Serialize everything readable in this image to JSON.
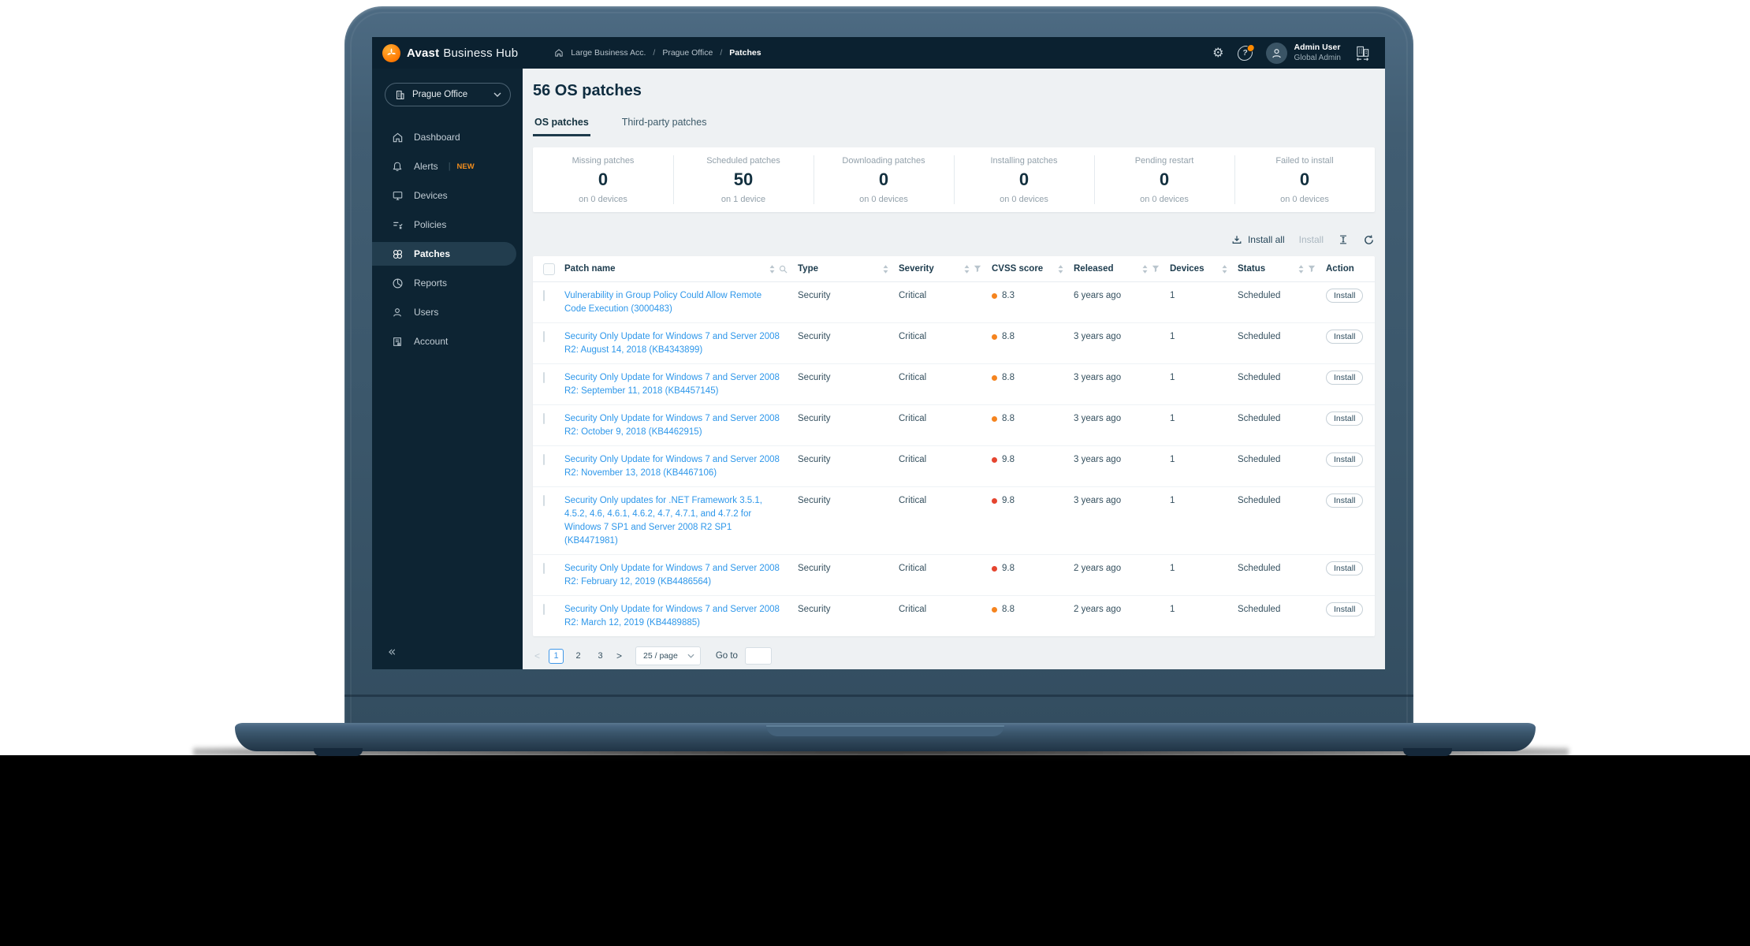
{
  "topbar": {
    "brand_bold": "Avast",
    "brand_rest": "Business Hub",
    "breadcrumbs": [
      "Large Business Acc.",
      "Prague Office",
      "Patches"
    ],
    "user": {
      "name": "Admin User",
      "role": "Global Admin"
    }
  },
  "sidebar": {
    "selector": "Prague Office",
    "collapse_glyph": "«",
    "items": [
      {
        "id": "dashboard",
        "label": "Dashboard",
        "active": false
      },
      {
        "id": "alerts",
        "label": "Alerts",
        "badge": "NEW",
        "active": false
      },
      {
        "id": "devices",
        "label": "Devices",
        "active": false
      },
      {
        "id": "policies",
        "label": "Policies",
        "active": false
      },
      {
        "id": "patches",
        "label": "Patches",
        "active": true
      },
      {
        "id": "reports",
        "label": "Reports",
        "active": false
      },
      {
        "id": "users",
        "label": "Users",
        "active": false
      },
      {
        "id": "account",
        "label": "Account",
        "active": false
      }
    ]
  },
  "main": {
    "title": "56 OS patches",
    "tabs": [
      {
        "label": "OS patches",
        "active": true
      },
      {
        "label": "Third-party patches",
        "active": false
      }
    ],
    "stats": [
      {
        "label": "Missing patches",
        "value": "0",
        "sub": "on 0 devices"
      },
      {
        "label": "Scheduled patches",
        "value": "50",
        "sub": "on 1 device"
      },
      {
        "label": "Downloading patches",
        "value": "0",
        "sub": "on 0 devices"
      },
      {
        "label": "Installing patches",
        "value": "0",
        "sub": "on 0 devices"
      },
      {
        "label": "Pending restart",
        "value": "0",
        "sub": "on 0 devices"
      },
      {
        "label": "Failed to install",
        "value": "0",
        "sub": "on 0 devices"
      }
    ],
    "toolbar": {
      "install_all": "Install all",
      "install": "Install"
    },
    "table": {
      "headers": [
        {
          "label": "",
          "checkbox": true
        },
        {
          "label": "Patch name",
          "sort": true,
          "search": true
        },
        {
          "label": "Type",
          "sort": true
        },
        {
          "label": "Severity",
          "sort": true,
          "filter": true
        },
        {
          "label": "CVSS score",
          "sort": true
        },
        {
          "label": "Released",
          "sort": true,
          "filter": true
        },
        {
          "label": "Devices",
          "sort": true
        },
        {
          "label": "Status",
          "sort": true,
          "filter": true
        },
        {
          "label": "Action"
        }
      ],
      "rows": [
        {
          "name": "Vulnerability in Group Policy Could Allow Remote Code Execution (3000483)",
          "type": "Security",
          "severity": "Critical",
          "cvss": "8.3",
          "cvss_level": "high",
          "released": "6 years ago",
          "devices": "1",
          "status": "Scheduled",
          "action": "Install"
        },
        {
          "name": "Security Only Update for Windows 7 and Server 2008 R2: August 14, 2018 (KB4343899)",
          "type": "Security",
          "severity": "Critical",
          "cvss": "8.8",
          "cvss_level": "high",
          "released": "3 years ago",
          "devices": "1",
          "status": "Scheduled",
          "action": "Install"
        },
        {
          "name": "Security Only Update for Windows 7 and Server 2008 R2: September 11, 2018 (KB4457145)",
          "type": "Security",
          "severity": "Critical",
          "cvss": "8.8",
          "cvss_level": "high",
          "released": "3 years ago",
          "devices": "1",
          "status": "Scheduled",
          "action": "Install"
        },
        {
          "name": "Security Only Update for Windows 7 and Server 2008 R2: October 9, 2018 (KB4462915)",
          "type": "Security",
          "severity": "Critical",
          "cvss": "8.8",
          "cvss_level": "high",
          "released": "3 years ago",
          "devices": "1",
          "status": "Scheduled",
          "action": "Install"
        },
        {
          "name": "Security Only Update for Windows 7 and Server 2008 R2: November 13, 2018 (KB4467106)",
          "type": "Security",
          "severity": "Critical",
          "cvss": "9.8",
          "cvss_level": "critical",
          "released": "3 years ago",
          "devices": "1",
          "status": "Scheduled",
          "action": "Install"
        },
        {
          "name": "Security Only updates for .NET Framework 3.5.1, 4.5.2, 4.6, 4.6.1, 4.6.2, 4.7, 4.7.1, and 4.7.2 for Windows 7 SP1 and Server 2008 R2 SP1 (KB4471981)",
          "type": "Security",
          "severity": "Critical",
          "cvss": "9.8",
          "cvss_level": "critical",
          "released": "3 years ago",
          "devices": "1",
          "status": "Scheduled",
          "action": "Install"
        },
        {
          "name": "Security Only Update for Windows 7 and Server 2008 R2: February 12, 2019 (KB4486564)",
          "type": "Security",
          "severity": "Critical",
          "cvss": "9.8",
          "cvss_level": "critical",
          "released": "2 years ago",
          "devices": "1",
          "status": "Scheduled",
          "action": "Install"
        },
        {
          "name": "Security Only Update for Windows 7 and Server 2008 R2: March 12, 2019 (KB4489885)",
          "type": "Security",
          "severity": "Critical",
          "cvss": "8.8",
          "cvss_level": "high",
          "released": "2 years ago",
          "devices": "1",
          "status": "Scheduled",
          "action": "Install"
        }
      ]
    },
    "pagination": {
      "prev": "<",
      "next": ">",
      "pages": [
        "1",
        "2",
        "3"
      ],
      "active_page": "1",
      "page_size": "25 / page",
      "goto_label": "Go to"
    }
  },
  "colors": {
    "accent_orange": "#ff7800",
    "badge_orange": "#f08c1e",
    "link_blue": "#2e97ea",
    "pagination_blue": "#3f97e8",
    "cvss_high": "#f5841f",
    "cvss_critical": "#e5452f",
    "topbar_bg": "#0b2130",
    "sidebar_bg": "#0d2433",
    "content_bg": "#eef1f3"
  }
}
